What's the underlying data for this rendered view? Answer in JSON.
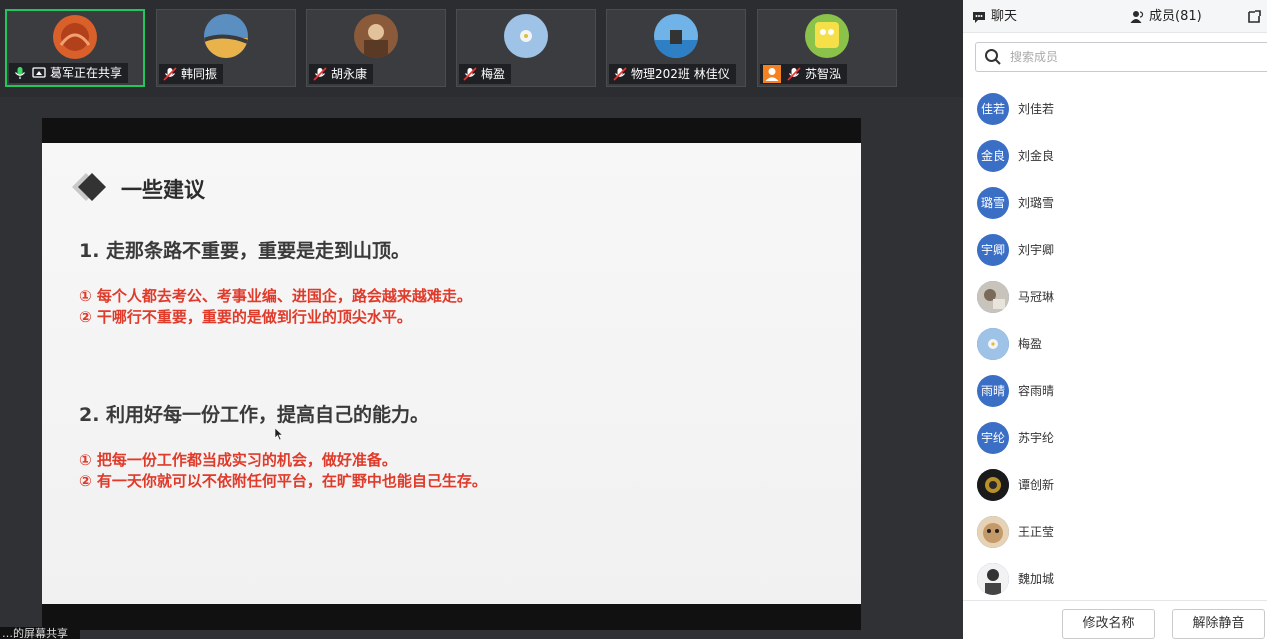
{
  "participants": [
    {
      "name": "葛军正在共享",
      "mic": "on",
      "screen": true
    },
    {
      "name": "韩同振",
      "mic": "muted"
    },
    {
      "name": "胡永康",
      "mic": "muted"
    },
    {
      "name": "梅盈",
      "mic": "muted"
    },
    {
      "name": "物理202班 林佳仪",
      "mic": "muted"
    },
    {
      "name": "苏智泓",
      "mic": "muted",
      "host_icon": true
    }
  ],
  "slide": {
    "title": "一些建议",
    "point1": "1.  走那条路不重要，重要是走到山顶。",
    "point1_a": "① 每个人都去考公、考事业编、进国企，路会越来越难走。",
    "point1_b": "② 干哪行不重要，重要的是做到行业的顶尖水平。",
    "point2": "2. 利用好每一份工作，提高自己的能力。",
    "point2_a": "① 把每一份工作都当成实习的机会，做好准备。",
    "point2_b": "② 有一天你就可以不依附任何平台，在旷野中也能自己生存。"
  },
  "share_label": "…的屏幕共享",
  "panel": {
    "tab_chat": "聊天",
    "tab_members": "成员(81)",
    "search_placeholder": "搜索成员",
    "members": [
      {
        "avatar_text": "佳若",
        "name": "刘佳若"
      },
      {
        "avatar_text": "金良",
        "name": "刘金良"
      },
      {
        "avatar_text": "璐雪",
        "name": "刘璐雪"
      },
      {
        "avatar_text": "宇卿",
        "name": "刘宇卿"
      },
      {
        "avatar_text": "",
        "name": "马冠琳"
      },
      {
        "avatar_text": "",
        "name": "梅盈"
      },
      {
        "avatar_text": "雨晴",
        "name": "容雨晴"
      },
      {
        "avatar_text": "宇纶",
        "name": "苏宇纶"
      },
      {
        "avatar_text": "",
        "name": "谭创新"
      },
      {
        "avatar_text": "",
        "name": "王正莹"
      },
      {
        "avatar_text": "",
        "name": "魏加城"
      }
    ],
    "rename_label": "修改名称",
    "unmute_label": "解除静音"
  },
  "colors": {
    "accent_red": "#e03a2a",
    "avatar_blue": "#3b6fc6",
    "active_speaker": "#22c55e",
    "host_orange": "#f58220"
  }
}
